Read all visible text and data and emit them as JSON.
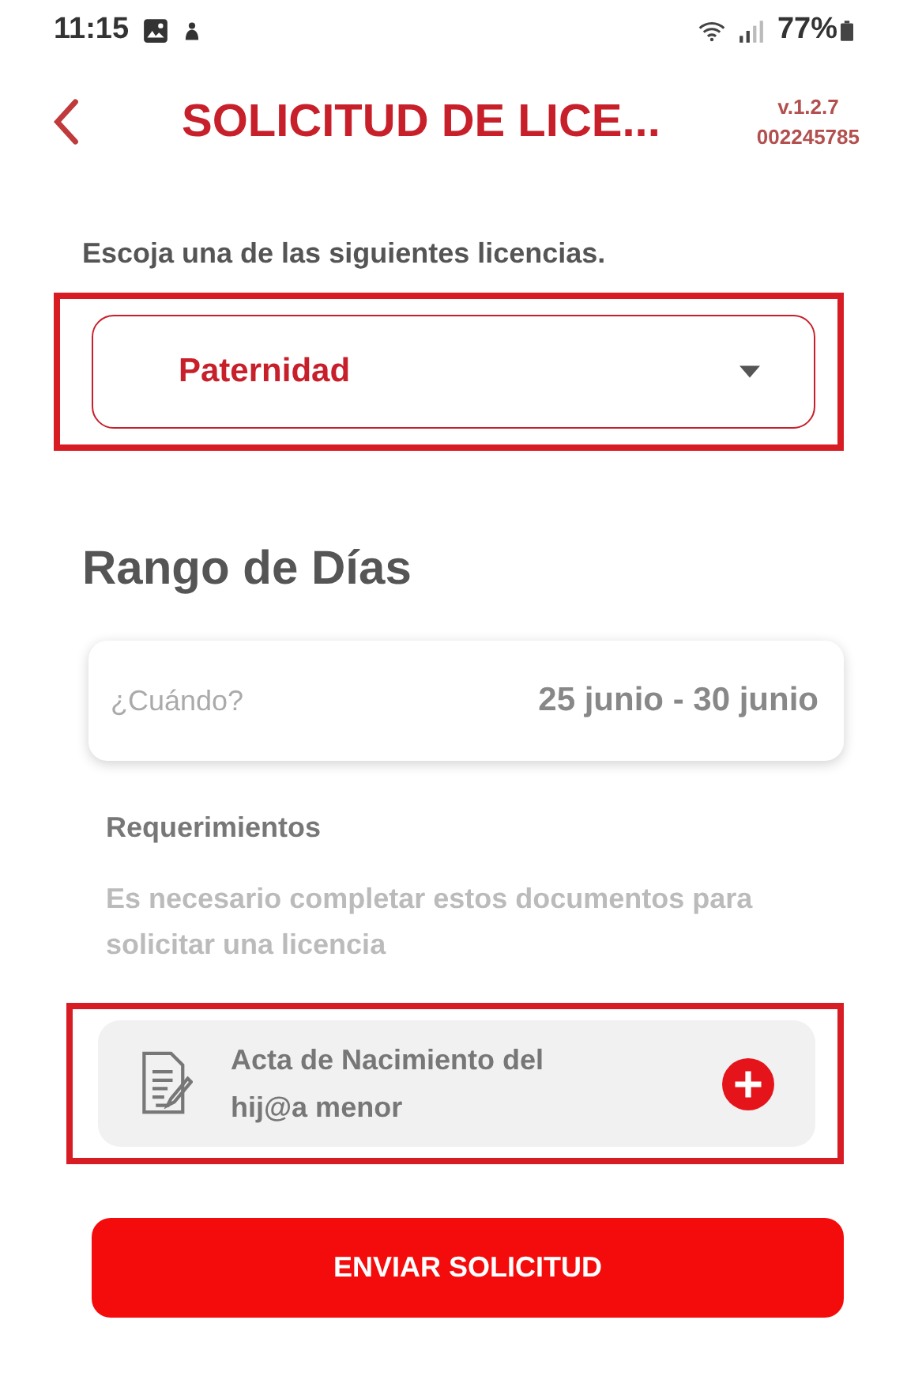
{
  "status_bar": {
    "time": "11:15",
    "battery": "77%"
  },
  "header": {
    "title": "SOLICITUD DE LICE...",
    "version": "v.1.2.7",
    "code": "002245785"
  },
  "prompt": "Escoja una de las siguientes licencias.",
  "license_select": {
    "value": "Paternidad",
    "highlighted": true
  },
  "range": {
    "heading": "Rango de Días",
    "label": "¿Cuándo?",
    "value": "25 junio - 30 junio"
  },
  "requirements": {
    "heading": "Requerimientos",
    "note": "Es necesario completar estos documentos para solicitar una licencia",
    "documents": [
      {
        "name": "Acta de Nacimiento del hij@a menor",
        "highlighted": true
      }
    ]
  },
  "submit": "ENVIAR SOLICITUD"
}
